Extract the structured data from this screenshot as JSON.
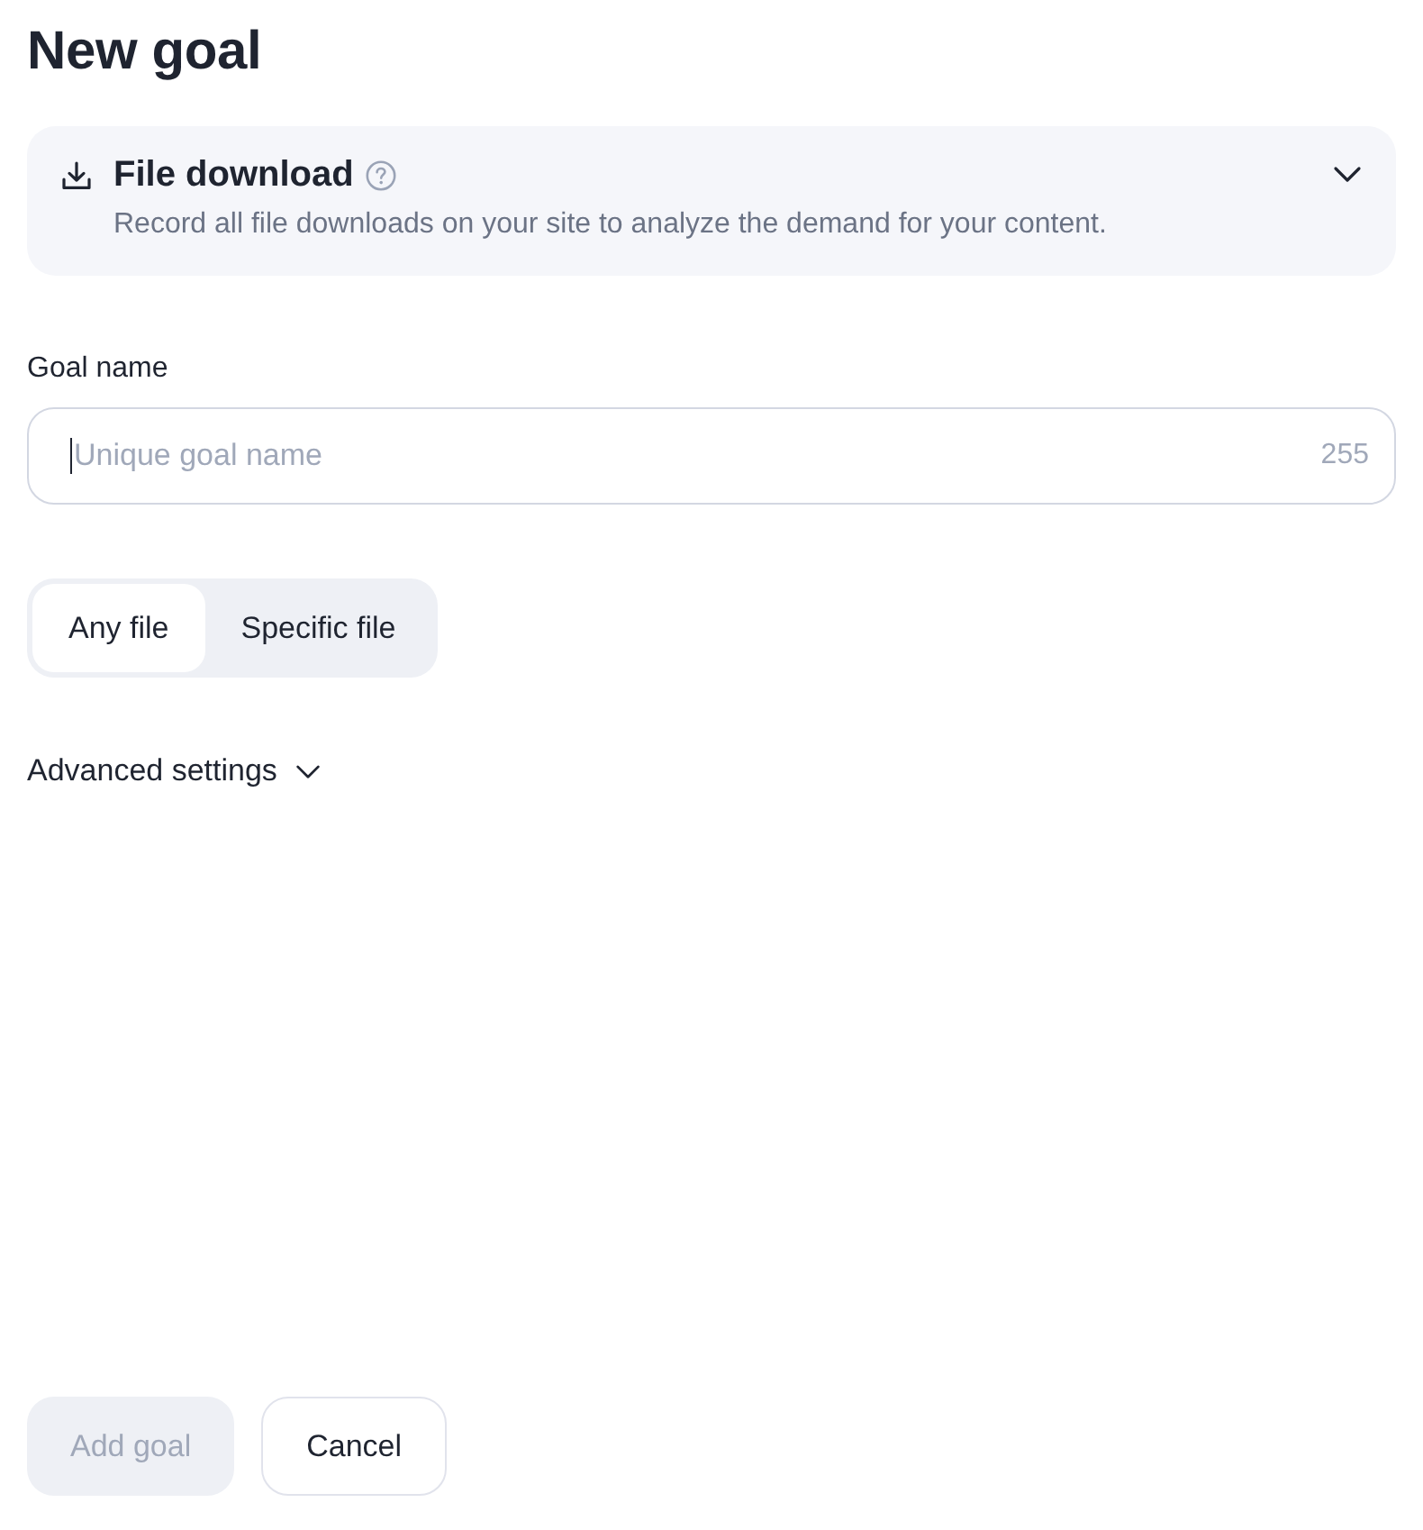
{
  "title": "New goal",
  "goal_type": {
    "title": "File download",
    "description": "Record all file downloads on your site to analyze the demand for your content.",
    "expanded": false
  },
  "goal_name": {
    "label": "Goal name",
    "placeholder": "Unique goal name",
    "counter": "255",
    "focused": true
  },
  "file_mode": [
    {
      "label": "Any file",
      "selected": true
    },
    {
      "label": "Specific file",
      "selected": false
    }
  ],
  "advanced_settings": {
    "label": "Advanced settings",
    "expanded": false
  },
  "buttons": [
    {
      "label": "Add goal",
      "kind": "primary",
      "disabled": true
    },
    {
      "label": "Cancel",
      "kind": "secondary",
      "disabled": false
    }
  ]
}
